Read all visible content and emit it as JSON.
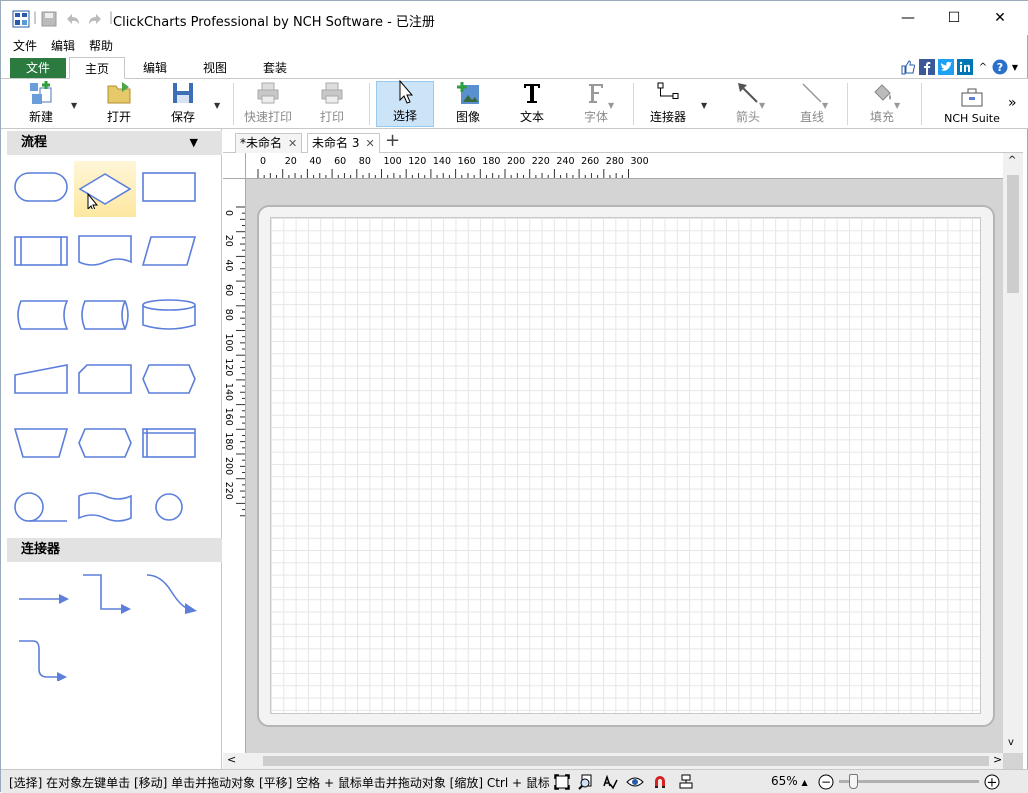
{
  "window": {
    "title": "ClickCharts Professional by NCH Software - 已注册",
    "minimize": "—",
    "maximize": "☐",
    "close": "✕",
    "title_sep": "|"
  },
  "menu": {
    "items": [
      "文件",
      "编辑",
      "帮助"
    ]
  },
  "ribbon_tabs": {
    "file": "文件",
    "items": [
      "主页",
      "编辑",
      "视图",
      "套装"
    ],
    "help": "?"
  },
  "toolbar": {
    "new": "新建",
    "open": "打开",
    "save": "保存",
    "quick_print": "快速打印",
    "print": "打印",
    "select": "选择",
    "image": "图像",
    "text": "文本",
    "font": "字体",
    "connector": "连接器",
    "arrow": "箭头",
    "line": "直线",
    "fill": "填充",
    "nch_suite": "NCH Suite",
    "more": "»"
  },
  "sidebar": {
    "section_flow": "流程",
    "section_flow_toggle": "▼",
    "section_connectors": "连接器"
  },
  "doc_tabs": [
    {
      "label": "*未命名",
      "close": "✕"
    },
    {
      "label": "未命名 3",
      "close": "✕"
    }
  ],
  "doc_tabs_add": "+",
  "ruler": {
    "h_labels": [
      "0",
      "20",
      "40",
      "60",
      "80",
      "100",
      "120",
      "140",
      "160",
      "180",
      "200",
      "220",
      "240",
      "260",
      "280",
      "300"
    ],
    "v_labels": [
      "0",
      "20",
      "40",
      "60",
      "80",
      "100",
      "120",
      "140",
      "160",
      "180",
      "200",
      "220"
    ]
  },
  "scroll": {
    "left": "<",
    "right": ">",
    "up": "^",
    "down": "v"
  },
  "status": {
    "text": "[选择] 在对象左键单击 [移动] 单击并拖动对象 [平移] 空格 + 鼠标单击并拖动对象 [缩放] Ctrl + 鼠标滚轮",
    "zoom": "65%",
    "zoom_caret": "▲",
    "zoom_minus": "−",
    "zoom_plus": "+"
  },
  "colors": {
    "file_tab": "#2b7a3f",
    "shape_stroke": "#5b7fdb",
    "connector": "#5b7fdb",
    "select_bg": "#cce4f7"
  }
}
